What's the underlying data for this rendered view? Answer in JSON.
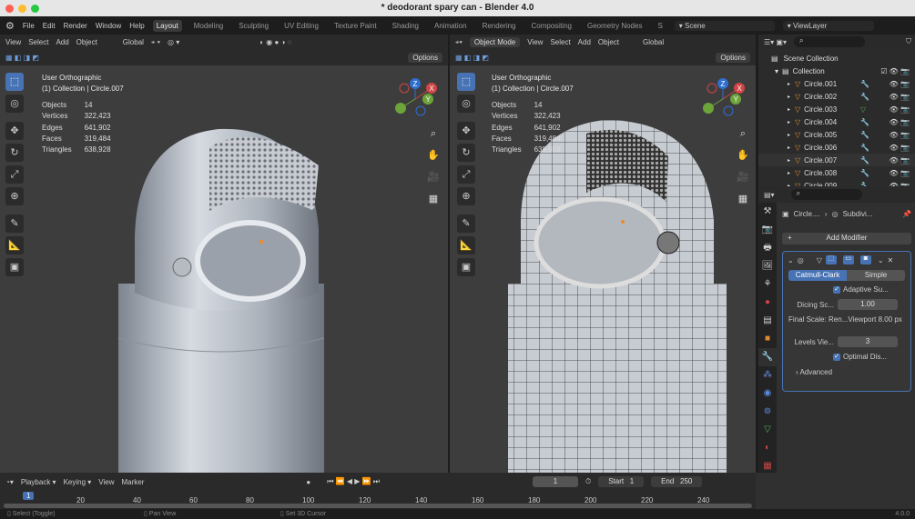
{
  "window": {
    "title": "* deodorant spary can - Blender 4.0"
  },
  "menu": [
    "File",
    "Edit",
    "Render",
    "Window",
    "Help"
  ],
  "workspaces": [
    "Layout",
    "Modeling",
    "Sculpting",
    "UV Editing",
    "Texture Paint",
    "Shading",
    "Animation",
    "Rendering",
    "Compositing",
    "Geometry Nodes",
    "S"
  ],
  "scene": "Scene",
  "view_layer": "ViewLayer",
  "left_viewport": {
    "menu": [
      "View",
      "Select",
      "Add",
      "Object"
    ],
    "orientation": "Global",
    "options": "Options",
    "view_name": "User Orthographic",
    "collection": "(1) Collection | Circle.007",
    "stats": [
      [
        "Objects",
        "14"
      ],
      [
        "Vertices",
        "322,423"
      ],
      [
        "Edges",
        "641,902"
      ],
      [
        "Faces",
        "319,484"
      ],
      [
        "Triangles",
        "638,928"
      ]
    ]
  },
  "right_viewport": {
    "mode": "Object Mode",
    "menu": [
      "View",
      "Select",
      "Add",
      "Object"
    ],
    "orientation": "Global",
    "options": "Options",
    "view_name": "User Orthographic",
    "collection": "(1) Collection | Circle.007",
    "stats": [
      [
        "Objects",
        "14"
      ],
      [
        "Vertices",
        "322,423"
      ],
      [
        "Edges",
        "641,902"
      ],
      [
        "Faces",
        "319,484"
      ],
      [
        "Triangles",
        "638,928"
      ]
    ]
  },
  "gizmo": {
    "x": "X",
    "y": "Y",
    "z": "Z"
  },
  "outliner": {
    "root": "Scene Collection",
    "collection": "Collection",
    "items": [
      "Circle.001",
      "Circle.002",
      "Circle.003",
      "Circle.004",
      "Circle.005",
      "Circle.006",
      "Circle.007",
      "Circle.008",
      "Circle.009"
    ]
  },
  "properties": {
    "breadcrumb_object": "Circle....",
    "breadcrumb_modifier": "Subdivi...",
    "add_modifier": "Add Modifier",
    "tab_catmull": "Catmull-Clark",
    "tab_simple": "Simple",
    "adaptive": "Adaptive Su...",
    "dicing_label": "Dicing Sc...",
    "dicing_value": "1.00",
    "final_scale": "Final Scale: Ren...Viewport 8.00 px",
    "levels_label": "Levels Vie...",
    "levels_value": "3",
    "optimal": "Optimal Dis...",
    "advanced": "Advanced"
  },
  "timeline": {
    "menu": [
      "Playback",
      "Keying",
      "View",
      "Marker"
    ],
    "current_frame": "1",
    "start_label": "Start",
    "start": "1",
    "end_label": "End",
    "end": "250",
    "ticks": [
      "20",
      "40",
      "60",
      "80",
      "100",
      "120",
      "140",
      "160",
      "180",
      "200",
      "220",
      "240"
    ]
  },
  "status": {
    "select": "Select (Toggle)",
    "pan": "Pan View",
    "cursor": "Set 3D Cursor",
    "version": "4.0.0"
  }
}
